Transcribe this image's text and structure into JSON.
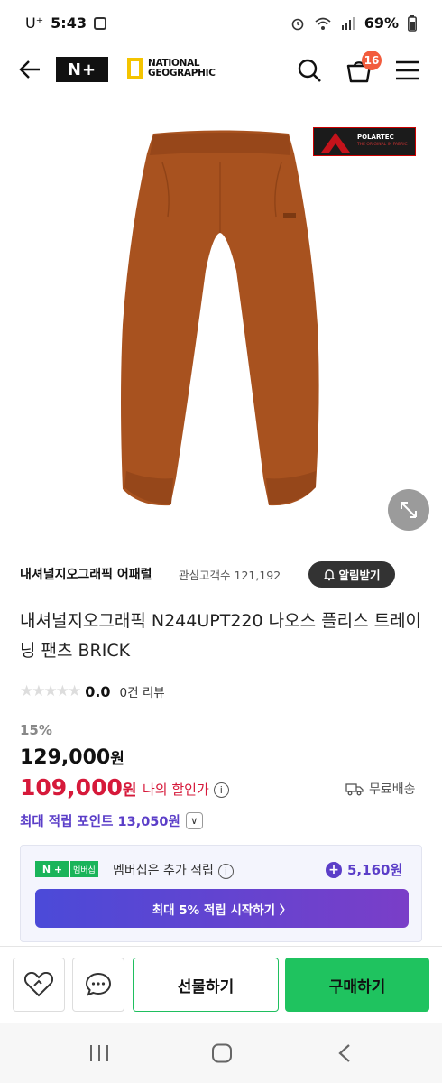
{
  "status_bar": {
    "carrier": "U⁺",
    "time": "5:43",
    "battery": "69%"
  },
  "header": {
    "logo_np": "N+",
    "logo_ng_line1": "NATIONAL",
    "logo_ng_line2": "GEOGRAPHIC",
    "cart_count": "16"
  },
  "product_image": {
    "badge_label": "POLARTEC",
    "badge_sub": "THE ORIGINAL IN FABRIC",
    "color": "#a8521f"
  },
  "brand": {
    "name": "내셔널지오그래픽 어패럴",
    "interest_label": "관심고객수",
    "interest_count": "121,192",
    "alarm_label": "알림받기"
  },
  "product": {
    "title": "내셔널지오그래픽 N244UPT220 나오스 플리스 트레이닝 팬츠 BRICK",
    "rating": "0.0",
    "rating_stars": 0,
    "review_count": "0건 리뷰",
    "discount": "15%",
    "original_price": "129,000",
    "sale_price": "109,000",
    "currency": "원",
    "my_price_label": "나의 할인가",
    "shipping": "무료배송",
    "points_label": "최대 적립 포인트 13,050원"
  },
  "membership": {
    "tag_n": "N +",
    "tag_text": "멤버십",
    "text": "멤버십은 추가 적립",
    "points": "5,160원",
    "cta": "최대 5% 적립 시작하기 〉"
  },
  "actions": {
    "gift": "선물하기",
    "buy": "구매하기"
  },
  "colors": {
    "accent_green": "#1fc35f",
    "sale_red": "#d6193a",
    "point_purple": "#5b3ec8"
  }
}
